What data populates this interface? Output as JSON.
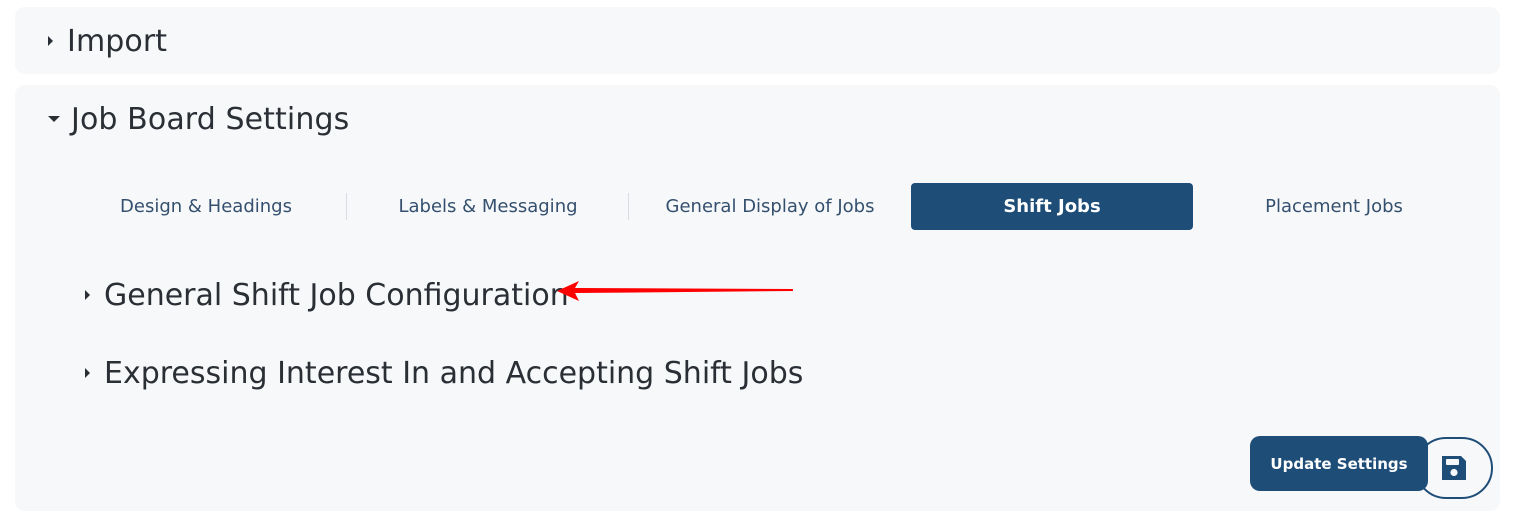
{
  "import_section": {
    "title": "Import",
    "expanded": false
  },
  "job_board_settings": {
    "title": "Job Board Settings",
    "expanded": true,
    "tabs": [
      {
        "label": "Design & Headings",
        "active": false
      },
      {
        "label": "Labels & Messaging",
        "active": false
      },
      {
        "label": "General Display of Jobs",
        "active": false
      },
      {
        "label": "Shift Jobs",
        "active": true
      },
      {
        "label": "Placement Jobs",
        "active": false
      }
    ],
    "subsections": [
      {
        "title": "General Shift Job Configuration",
        "expanded": false
      },
      {
        "title": "Expressing Interest In and Accepting Shift Jobs",
        "expanded": false
      }
    ],
    "update_button_label": "Update Settings",
    "save_icon": "floppy-disk-icon"
  },
  "annotation": {
    "type": "red-arrow-icon",
    "color": "#ff0000"
  },
  "colors": {
    "accent": "#1e4d78",
    "panel_bg": "#f7f8fa",
    "tab_text": "#34506e"
  }
}
